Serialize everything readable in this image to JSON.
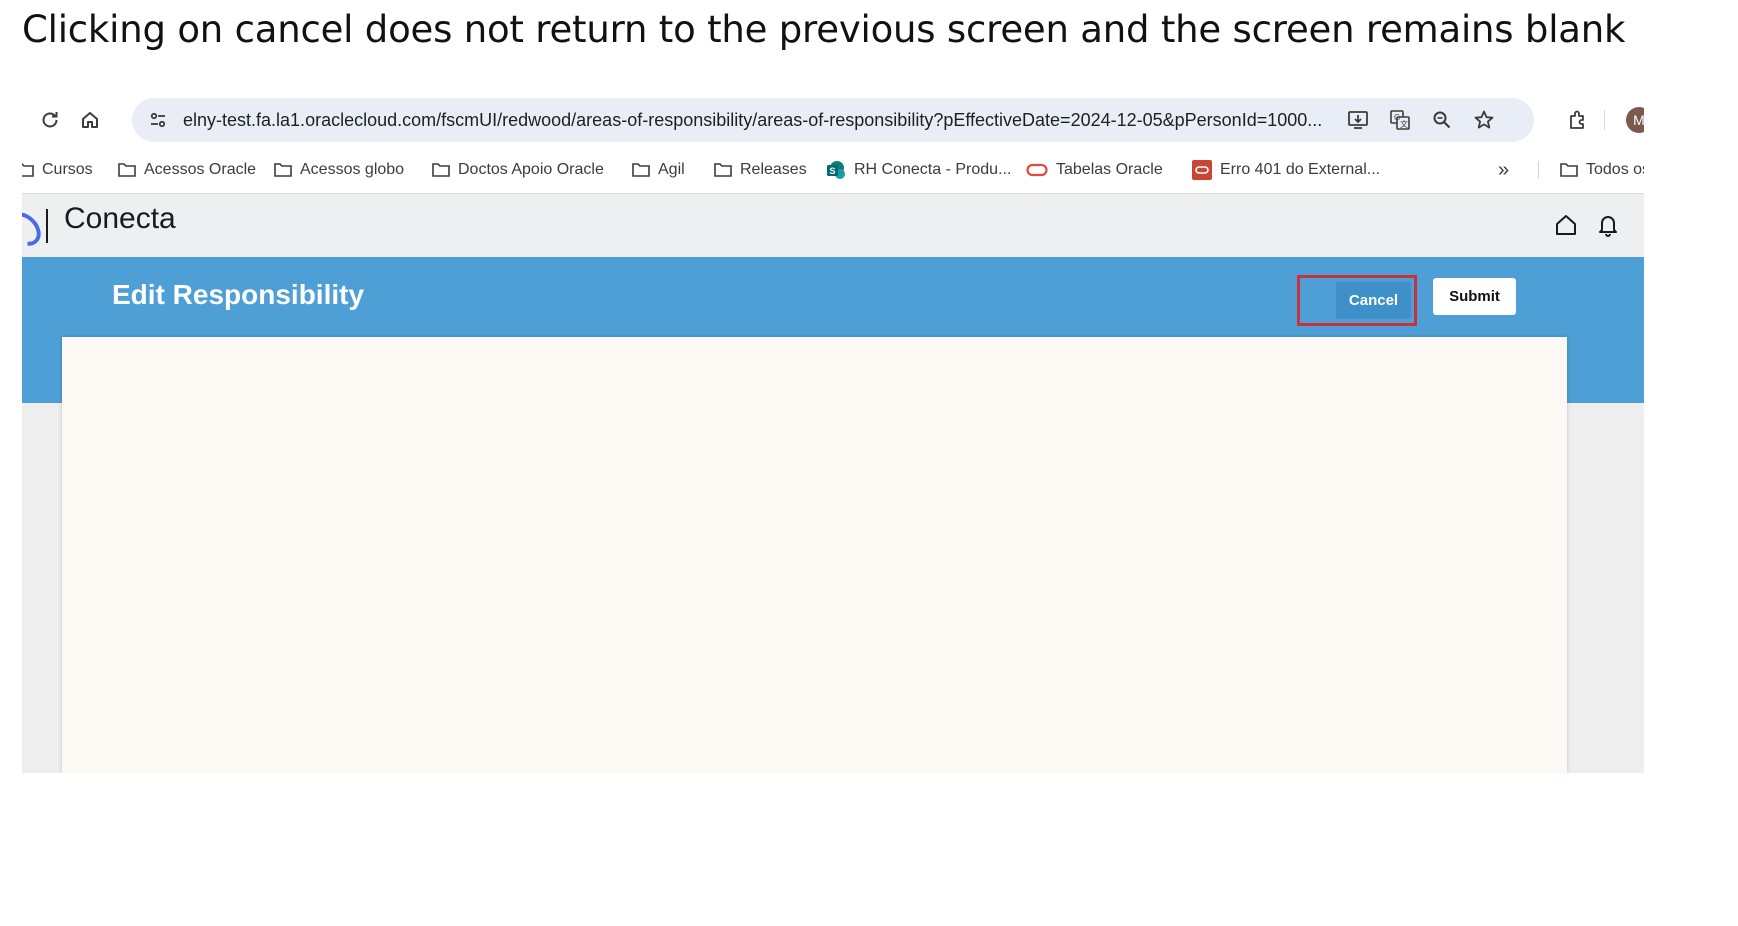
{
  "caption": "Clicking on cancel does not return to the previous screen and the screen remains blank",
  "browser": {
    "url": "elny-test.fa.la1.oraclecloud.com/fscmUI/redwood/areas-of-responsibility/areas-of-responsibility?pEffectiveDate=2024-12-05&pPersonId=1000...",
    "profile_initial": "M"
  },
  "bookmarks": {
    "items": [
      {
        "label": "Cursos",
        "icon": "folder-icon"
      },
      {
        "label": "Acessos Oracle",
        "icon": "folder-icon"
      },
      {
        "label": "Acessos globo",
        "icon": "folder-icon"
      },
      {
        "label": "Doctos Apoio Oracle",
        "icon": "folder-icon"
      },
      {
        "label": "Agil",
        "icon": "folder-icon"
      },
      {
        "label": "Releases",
        "icon": "folder-icon"
      },
      {
        "label": "RH Conecta - Produ...",
        "icon": "sharepoint-icon"
      },
      {
        "label": "Tabelas Oracle",
        "icon": "oracle-icon"
      },
      {
        "label": "Erro 401 do External...",
        "icon": "oracle-red-icon"
      }
    ],
    "overflow": "»",
    "other_folder": "Todos os fa"
  },
  "app": {
    "brand": "Conecta"
  },
  "page": {
    "title": "Edit Responsibility",
    "cancel_label": "Cancel",
    "submit_label": "Submit"
  },
  "colors": {
    "band": "#4d9fd6",
    "highlight": "#c6333b",
    "panel": "#fcf9f5"
  }
}
